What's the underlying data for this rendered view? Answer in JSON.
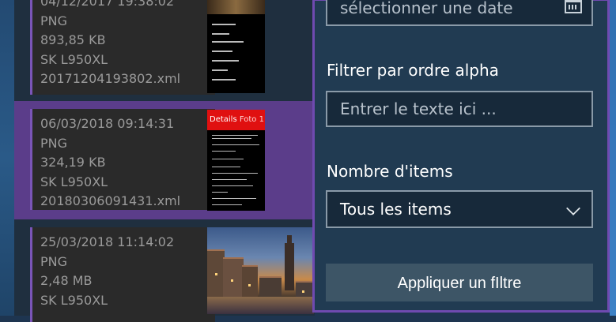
{
  "files": [
    {
      "date": "04/12/2017 19:38:02",
      "format": "PNG",
      "size": "893,85 KB",
      "device": "SK L950XL",
      "filename": "20171204193802.xml"
    },
    {
      "date": "06/03/2018 09:14:31",
      "format": "PNG",
      "size": "324,19 KB",
      "device": "SK L950XL",
      "filename": "20180306091431.xml",
      "thumb_header": "Details",
      "thumb_header_accent": "Foto 1"
    },
    {
      "date": "25/03/2018 11:14:02",
      "format": "PNG",
      "size": "2,48 MB",
      "device": "SK L950XL"
    }
  ],
  "filter_panel": {
    "date_placeholder": "sélectionner une date",
    "alpha_label": "Filtrer par ordre alpha",
    "alpha_placeholder": "Entrer le texte ici ...",
    "count_label": "Nombre d'items",
    "count_value": "Tous les items",
    "apply_label": "Appliquer un fIltre"
  },
  "colors": {
    "selection": "#5b3d8a",
    "panel_border": "#6f4ab0",
    "thumb_header_red": "#e01010"
  },
  "icons": [
    "calendar-icon",
    "chevron-down-icon"
  ]
}
